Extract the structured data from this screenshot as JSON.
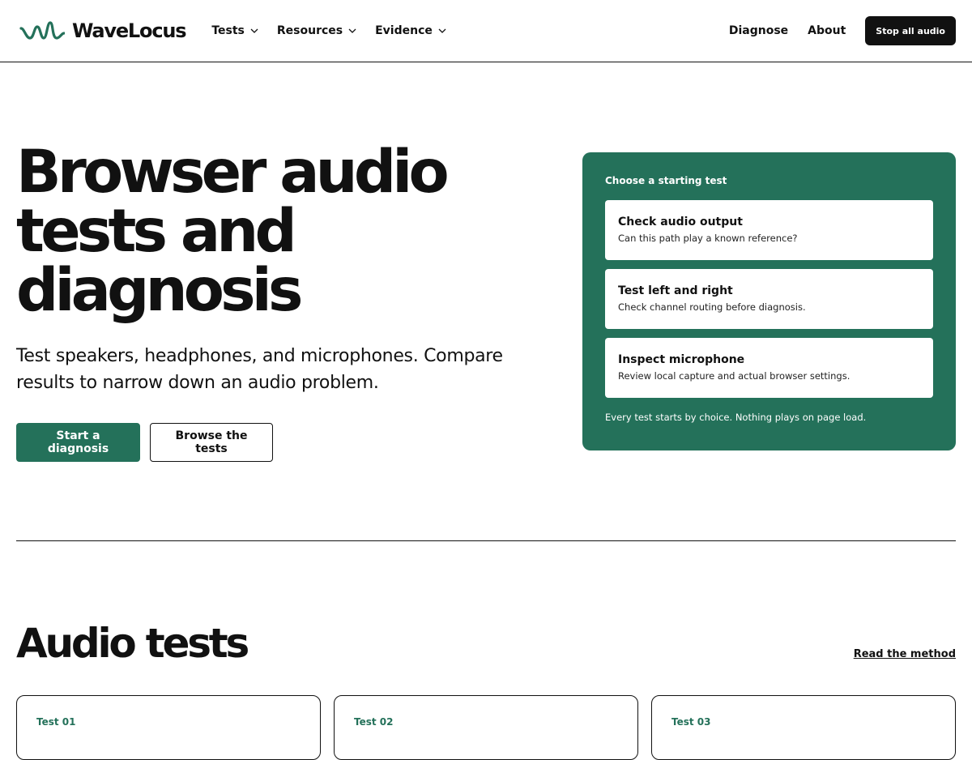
{
  "header": {
    "brand_name": "WaveLocus",
    "logo_icon": "waveform-logo-icon",
    "nav": [
      {
        "label": "Tests",
        "icon": "chevron-down-icon"
      },
      {
        "label": "Resources",
        "icon": "chevron-down-icon"
      },
      {
        "label": "Evidence",
        "icon": "chevron-down-icon"
      }
    ],
    "links": [
      "Diagnose",
      "About"
    ],
    "stop_button": "Stop all audio"
  },
  "hero": {
    "title": "Browser audio tests and diagnosis",
    "subtitle": "Test speakers, headphones, and microphones. Compare results to narrow down an audio problem.",
    "primary_button": "Start a diagnosis",
    "secondary_button": "Browse the tests"
  },
  "panel": {
    "heading": "Choose a starting test",
    "choices": [
      {
        "title": "Check audio output",
        "description": "Can this path play a known reference?"
      },
      {
        "title": "Test left and right",
        "description": "Check channel routing before diagnosis."
      },
      {
        "title": "Inspect microphone",
        "description": "Review local capture and actual browser settings."
      }
    ],
    "note": "Every test starts by choice. Nothing plays on page load."
  },
  "tests_section": {
    "title": "Audio tests",
    "read_method_link": "Read the method",
    "cards": [
      {
        "label": "Test 01"
      },
      {
        "label": "Test 02"
      },
      {
        "label": "Test 03"
      }
    ]
  },
  "colors": {
    "accent": "#24715a",
    "ink": "#111111",
    "background": "#ffffff"
  }
}
